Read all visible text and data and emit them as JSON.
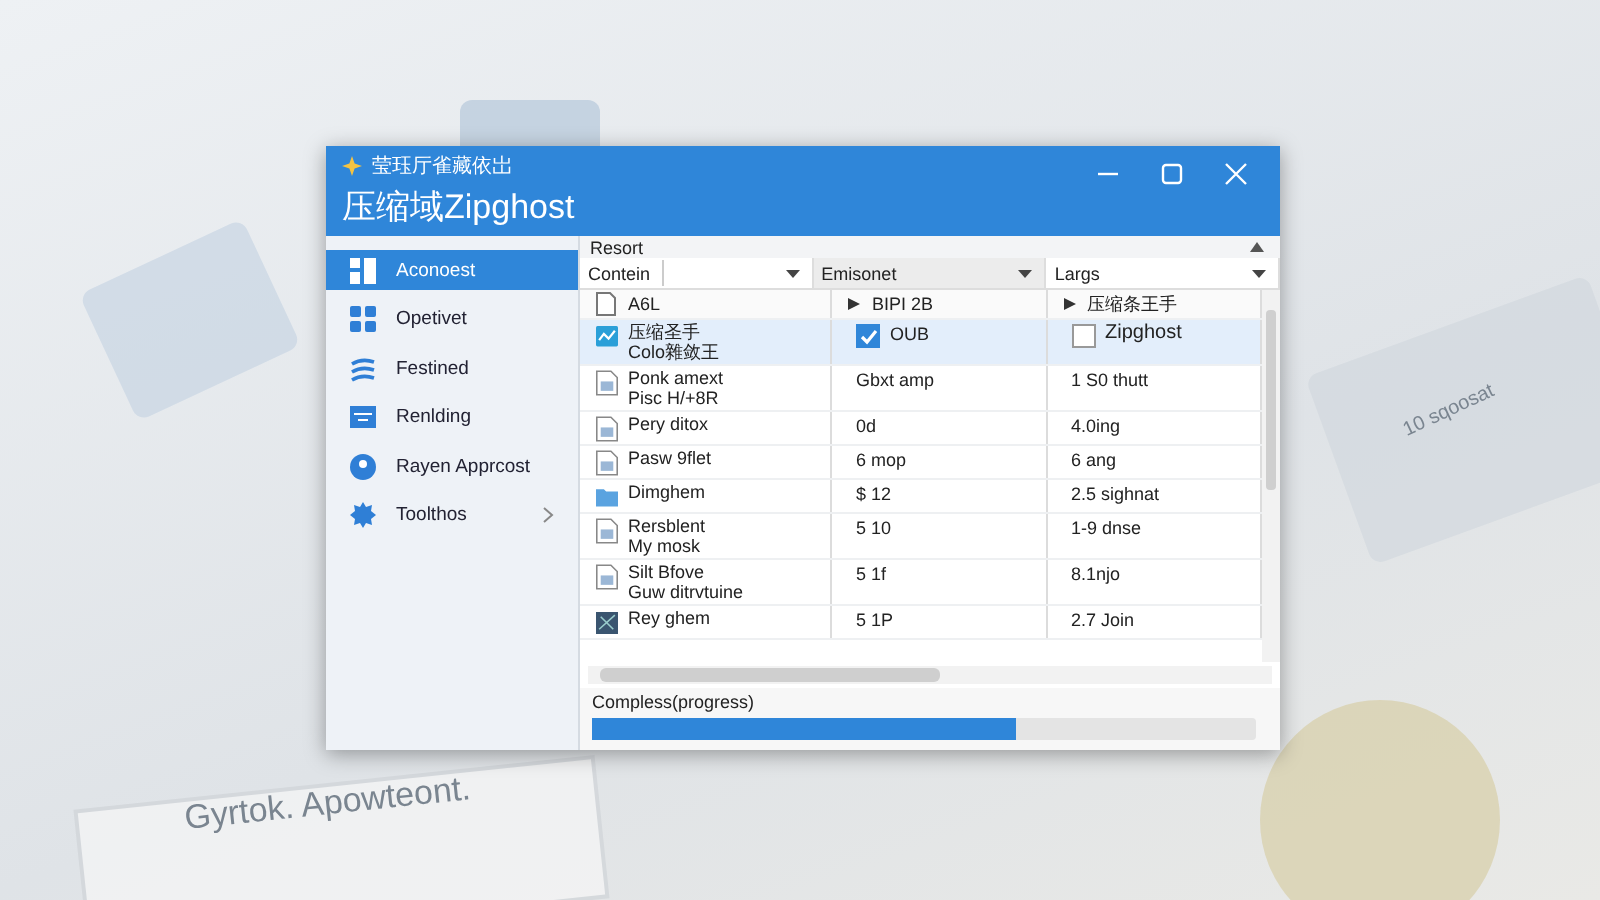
{
  "backdrop": {
    "captions": [
      "Gyrtok. Apowteont.",
      "10 sqoosat"
    ]
  },
  "window": {
    "app_name": "莹珏厅雀藏依岀",
    "title": "压缩域Zipghost"
  },
  "sidebar": {
    "items": [
      {
        "label": "Aconoest",
        "kind": "split",
        "selected": true,
        "expandable": false
      },
      {
        "label": "Opetivet",
        "kind": "tiles",
        "selected": false,
        "expandable": false
      },
      {
        "label": "Festined",
        "kind": "waves",
        "selected": false,
        "expandable": false
      },
      {
        "label": "Renlding",
        "kind": "panel",
        "selected": false,
        "expandable": false
      },
      {
        "label": "Rayen Apprcost",
        "kind": "badge",
        "selected": false,
        "expandable": false
      },
      {
        "label": "Toolthos",
        "kind": "gear",
        "selected": false,
        "expandable": true
      }
    ]
  },
  "section": {
    "title": "Resort"
  },
  "filters": [
    {
      "label": "Contein",
      "has_field": true
    },
    {
      "label": "Emisonet",
      "has_field": false
    },
    {
      "label": "Largs",
      "has_field": false
    }
  ],
  "table": {
    "columns": [
      "A6L",
      "BIPI 2B",
      "压缩条王手"
    ],
    "rows": [
      {
        "kind": "chart",
        "name": [
          "压缩圣手",
          "Colo雜敛王"
        ],
        "cells": [
          {
            "text": "OUB",
            "checked": true
          },
          {
            "text": "Zipghost",
            "checked": false
          }
        ],
        "selected": true
      },
      {
        "kind": "doc",
        "name": [
          "Ponk amext",
          "Pisc H/+8R"
        ],
        "cells": [
          {
            "text": "Gbxt amp"
          },
          {
            "text": "1 S0 thutt"
          }
        ],
        "selected": false
      },
      {
        "kind": "doc",
        "name": [
          "Pery ditox"
        ],
        "cells": [
          {
            "text": "0d"
          },
          {
            "text": "4.0ing"
          }
        ],
        "selected": false
      },
      {
        "kind": "doc",
        "name": [
          "Pasw 9flet"
        ],
        "cells": [
          {
            "text": "6 mop"
          },
          {
            "text": "6 ang"
          }
        ],
        "selected": false
      },
      {
        "kind": "folder",
        "name": [
          "Dimghem"
        ],
        "cells": [
          {
            "text": "$ 12"
          },
          {
            "text": "2.5 sighnat"
          }
        ],
        "selected": false
      },
      {
        "kind": "doc",
        "name": [
          "Rersblent",
          "My mosk"
        ],
        "cells": [
          {
            "text": "5 10"
          },
          {
            "text": "1-9 dnse"
          }
        ],
        "selected": false
      },
      {
        "kind": "doc",
        "name": [
          "Silt Bfove",
          "Guw ditrvtuine"
        ],
        "cells": [
          {
            "text": "5 1f"
          },
          {
            "text": "8.1njo"
          }
        ],
        "selected": false
      },
      {
        "kind": "image",
        "name": [
          "Rey ghem"
        ],
        "cells": [
          {
            "text": "5 1P"
          },
          {
            "text": "2.7 Join"
          }
        ],
        "selected": false
      }
    ]
  },
  "progress": {
    "label": "Compless(progress)",
    "level": 0.64
  }
}
